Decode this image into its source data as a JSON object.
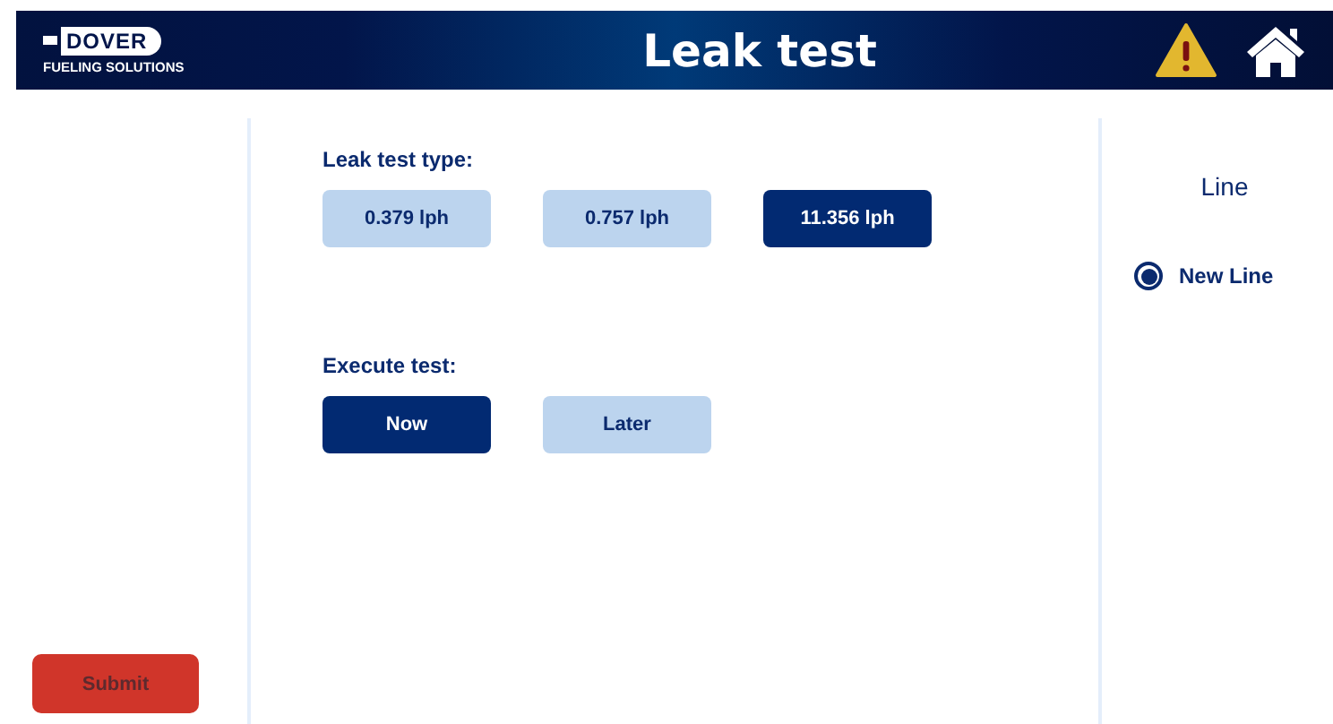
{
  "header": {
    "logo": {
      "name": "DOVER",
      "tagline": "FUELING SOLUTIONS"
    },
    "title": "Leak test"
  },
  "sidebar": {
    "submit": "Submit"
  },
  "groups": [
    {
      "label": "Leak test type:",
      "options": [
        {
          "label": "0.379 lph",
          "selected": false
        },
        {
          "label": "0.757 lph",
          "selected": false
        },
        {
          "label": "11.356 lph",
          "selected": true
        }
      ]
    },
    {
      "label": "Execute test:",
      "options": [
        {
          "label": "Now",
          "selected": true
        },
        {
          "label": "Later",
          "selected": false
        }
      ]
    }
  ],
  "right_panel": {
    "title": "Line",
    "radios": [
      {
        "label": "New Line",
        "selected": true
      }
    ]
  }
}
